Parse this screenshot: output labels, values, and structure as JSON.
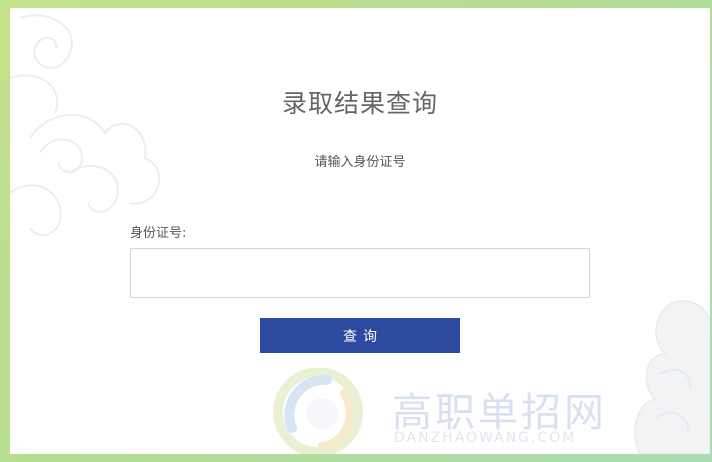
{
  "page": {
    "title": "录取结果查询",
    "subtitle": "请输入身份证号"
  },
  "form": {
    "id_label": "身份证号:",
    "id_value": "",
    "id_placeholder": "",
    "submit_label": "查询"
  },
  "watermark": {
    "text": "高职单招网",
    "subtext": "DANZHAOWANG.COM"
  },
  "colors": {
    "frame_gradient_start": "#c5e08a",
    "frame_gradient_end": "#a9dcb3",
    "button_bg": "#2b4aa0",
    "title_text": "#666666"
  },
  "icons": {
    "background_decoration": "cloud-pattern",
    "watermark_logo": "circular-swirl-logo"
  }
}
